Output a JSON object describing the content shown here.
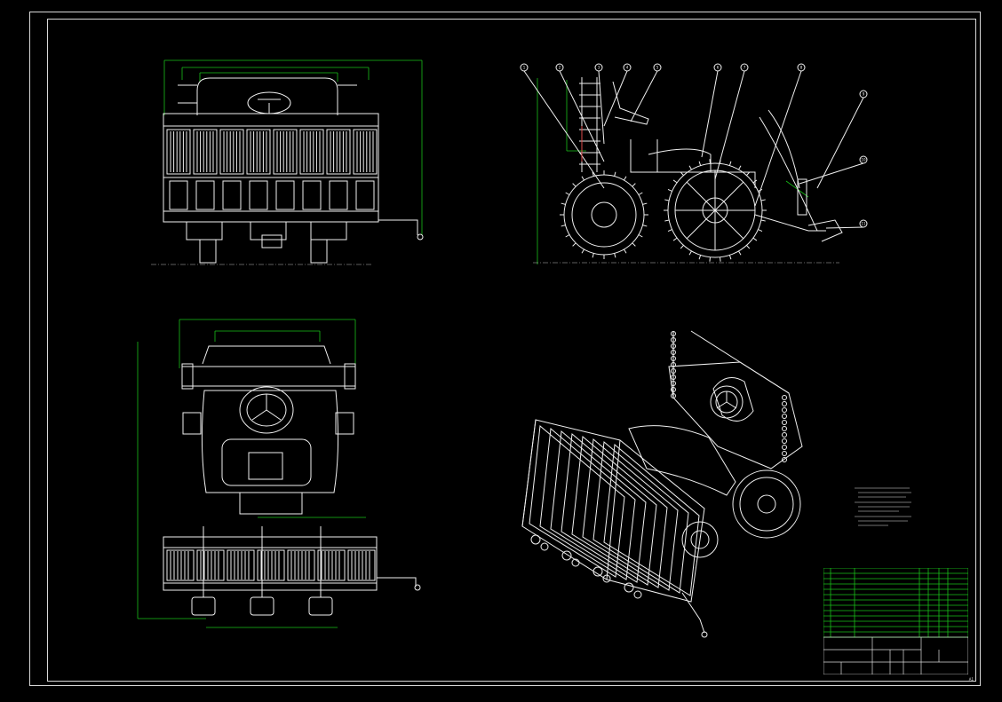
{
  "drawing": {
    "title": "",
    "sheet_size": "A1"
  },
  "colors": {
    "background": "#000000",
    "geometry": "#f0f0f0",
    "dimension": "#18c018",
    "highlight": "#dd2222"
  },
  "views": [
    {
      "name": "front-view"
    },
    {
      "name": "side-view"
    },
    {
      "name": "top-view"
    },
    {
      "name": "isometric-view"
    }
  ],
  "balloons": [
    "1",
    "2",
    "3",
    "4",
    "5",
    "6",
    "7",
    "8",
    "9",
    "10",
    "11"
  ],
  "notes": {
    "heading": "",
    "lines": []
  },
  "title_block": {
    "parts_rows": 13
  }
}
